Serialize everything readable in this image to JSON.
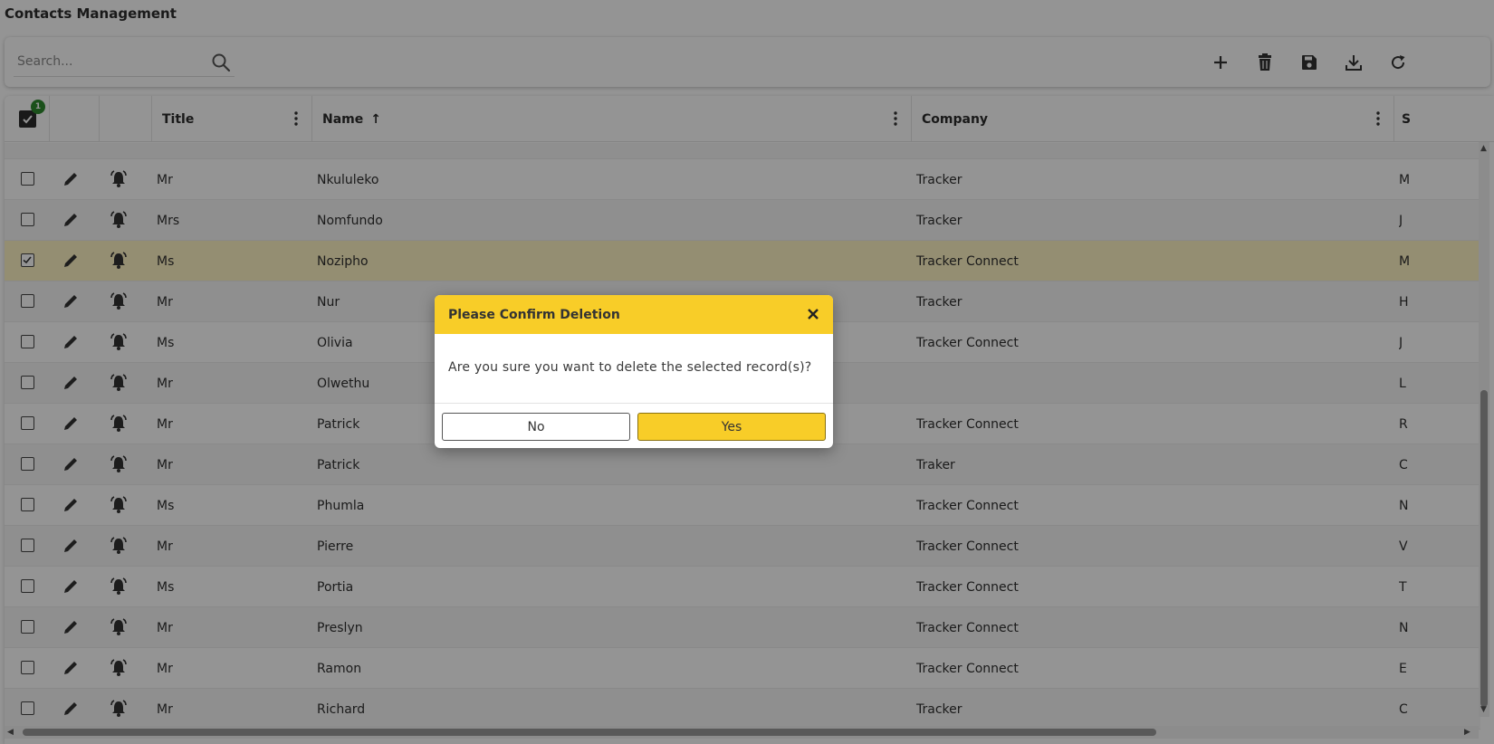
{
  "app": {
    "title": "Contacts Management"
  },
  "search": {
    "placeholder": "Search..."
  },
  "toolbar": {
    "buttons": [
      {
        "name": "add-button",
        "icon": "plus-icon"
      },
      {
        "name": "delete-button",
        "icon": "trash-icon"
      },
      {
        "name": "save-button",
        "icon": "floppy-icon"
      },
      {
        "name": "download-button",
        "icon": "download-icon"
      },
      {
        "name": "refresh-button",
        "icon": "refresh-icon"
      }
    ]
  },
  "grid": {
    "selected_count": "1",
    "columns": {
      "title": "Title",
      "name": "Name",
      "company": "Company",
      "extra": "S"
    },
    "sort_indicator": "↑",
    "rows": [
      {
        "title": "Mr",
        "name": "Nkululeko",
        "company": "Tracker",
        "extra": "M",
        "checked": false
      },
      {
        "title": "Mrs",
        "name": "Nomfundo",
        "company": "Tracker",
        "extra": "J",
        "checked": false
      },
      {
        "title": "Ms",
        "name": "Nozipho",
        "company": "Tracker Connect",
        "extra": "M",
        "checked": true
      },
      {
        "title": "Mr",
        "name": "Nur",
        "company": "Tracker",
        "extra": "H",
        "checked": false
      },
      {
        "title": "Ms",
        "name": "Olivia",
        "company": "Tracker Connect",
        "extra": "J",
        "checked": false
      },
      {
        "title": "Mr",
        "name": "Olwethu",
        "company": "",
        "extra": "L",
        "checked": false
      },
      {
        "title": "Mr",
        "name": "Patrick",
        "company": "Tracker Connect",
        "extra": "R",
        "checked": false
      },
      {
        "title": "Mr",
        "name": "Patrick",
        "company": "Traker",
        "extra": "C",
        "checked": false
      },
      {
        "title": "Ms",
        "name": "Phumla",
        "company": "Tracker Connect",
        "extra": "N",
        "checked": false
      },
      {
        "title": "Mr",
        "name": "Pierre",
        "company": "Tracker Connect",
        "extra": "V",
        "checked": false
      },
      {
        "title": "Ms",
        "name": "Portia",
        "company": "Tracker Connect",
        "extra": "T",
        "checked": false
      },
      {
        "title": "Mr",
        "name": "Preslyn",
        "company": "Tracker Connect",
        "extra": "N",
        "checked": false
      },
      {
        "title": "Mr",
        "name": "Ramon",
        "company": "Tracker Connect",
        "extra": "E",
        "checked": false
      },
      {
        "title": "Mr",
        "name": "Richard",
        "company": "Tracker",
        "extra": "C",
        "checked": false
      }
    ]
  },
  "dialog": {
    "title": "Please Confirm Deletion",
    "message": "Are you sure you want to delete the selected record(s)?",
    "no_label": "No",
    "yes_label": "Yes"
  },
  "colors": {
    "accent": "#f8cd28",
    "badge": "#2e8b2e",
    "selected_row": "#fff4c4"
  }
}
